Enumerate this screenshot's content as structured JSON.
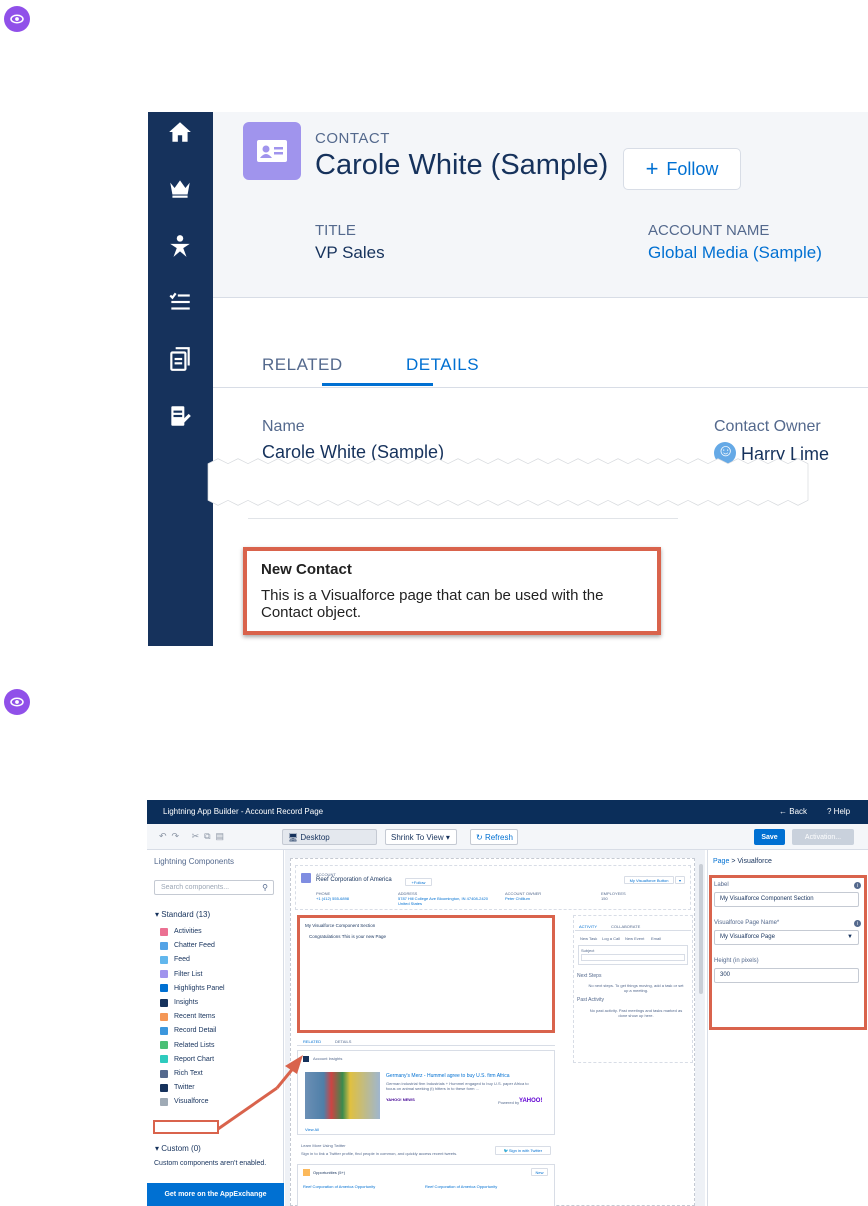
{
  "figure1": {
    "object_label": "CONTACT",
    "record_title": "Carole White (Sample)",
    "follow_label": "Follow",
    "title_label": "TITLE",
    "title_value": "VP Sales",
    "account_label": "ACCOUNT NAME",
    "account_value": "Global Media (Sample)",
    "tabs": [
      {
        "label": "RELATED"
      },
      {
        "label": "DETAILS"
      }
    ],
    "name_label": "Name",
    "name_value": "Carole White (Sample)",
    "owner_label": "Contact Owner",
    "owner_value": "Harry Lime",
    "vf_heading": "New Contact",
    "vf_text": "This is a Visualforce page that can be used with the Contact object.",
    "nav_icons": [
      "home-icon",
      "crown-icon",
      "person-star-icon",
      "checklist-icon",
      "documents-icon",
      "notebook-edit-icon"
    ]
  },
  "figure2": {
    "app_title": "Lightning App Builder - Account Record Page",
    "back_label": "Back",
    "help_label": "Help",
    "device_label": "Desktop",
    "zoom_label": "Shrink To View",
    "refresh_label": "Refresh",
    "save_label": "Save",
    "activation_label": "Activation...",
    "components_title": "Lightning Components",
    "search_placeholder": "Search components...",
    "standard_group": "Standard (13)",
    "components": [
      {
        "label": "Activities",
        "color": "#eb7092"
      },
      {
        "label": "Chatter Feed",
        "color": "#54a3e6"
      },
      {
        "label": "Feed",
        "color": "#62b7ed"
      },
      {
        "label": "Filter List",
        "color": "#a094ed"
      },
      {
        "label": "Highlights Panel",
        "color": "#0070d2"
      },
      {
        "label": "Insights",
        "color": "#16325c"
      },
      {
        "label": "Recent Items",
        "color": "#f49756"
      },
      {
        "label": "Record Detail",
        "color": "#3c97dd"
      },
      {
        "label": "Related Lists",
        "color": "#4bc076"
      },
      {
        "label": "Report Chart",
        "color": "#2ecbbe"
      },
      {
        "label": "Rich Text",
        "color": "#54698d"
      },
      {
        "label": "Twitter",
        "color": "#16325c"
      },
      {
        "label": "Visualforce",
        "color": "#9faab5"
      }
    ],
    "custom_group": "Custom (0)",
    "custom_note": "Custom components aren't enabled.",
    "appexchange_label": "Get more on the AppExchange",
    "canvas": {
      "account_type": "ACCOUNT",
      "account_name": "Reef Corporation of America",
      "follow": "Follow",
      "vf_button": "My Visualforce Button",
      "field_phone_label": "PHONE",
      "field_phone": "+1 (412) 555-6898",
      "field_address_label": "ADDRESS",
      "field_address": "5787 Hill College Ave Bloomington, IN 47408-2420 United States",
      "field_owner_label": "ACCOUNT OWNER",
      "field_owner": "Peter Chillium",
      "field_employees_label": "EMPLOYEES",
      "field_employees": "150",
      "vf_section_title": "My Visualforce Component Section",
      "vf_section_text": "Congratulations This is your new Page",
      "tab_related": "RELATED",
      "tab_details": "DETAILS",
      "activity_tab": "ACTIVITY",
      "collab_tab": "COLLABORATE",
      "activity_subtabs": [
        "New Task",
        "Log a Call",
        "New Event",
        "Email"
      ],
      "subject_label": "Subject",
      "next_steps": "Next Steps",
      "next_steps_text": "No next steps. To get things moving, add a task or set up a meeting.",
      "past_activity": "Past Activity",
      "past_activity_text": "No past activity. Past meetings and tasks marked as done show up here.",
      "insights_title": "Account Insights",
      "news_headline": "Germany's Merz - Hummel agree to buy U.S. firm Africa",
      "news_body": "German industrial firm Industrials + Hummel engaged to buy U.S. paper Africa to focus on animal seeking (t) hitters in to these form ...",
      "news_source": "YAHOO! NEWS",
      "powered_by": "Powered by",
      "yahoo": "YAHOO!",
      "view_all": "View All",
      "twitter_title": "Learn More Using Twitter",
      "twitter_text": "Sign in to link a Twitter profile, find people in common, and quickly access recent tweets.",
      "twitter_btn": "Sign in with Twitter",
      "opps_title": "Opportunities (5+)",
      "opps_new": "New",
      "opp1": "Reef Corporation of America Opportunity",
      "opp2": "Reef Corporation of America Opportunity"
    },
    "props": {
      "crumb_page": "Page",
      "crumb_sep": ">",
      "crumb_current": "Visualforce",
      "label_label": "Label",
      "label_value": "My Visualforce Component Section",
      "page_name_label": "Visualforce Page Name*",
      "page_name_value": "My Visualforce Page",
      "height_label": "Height (in pixels)",
      "height_value": "300"
    }
  },
  "colors": {
    "nav": "#16325c",
    "accent": "#0070d2",
    "highlight_border": "#d9634c",
    "eye_badge": "#9050e9",
    "contact_icon": "#a094ed"
  }
}
